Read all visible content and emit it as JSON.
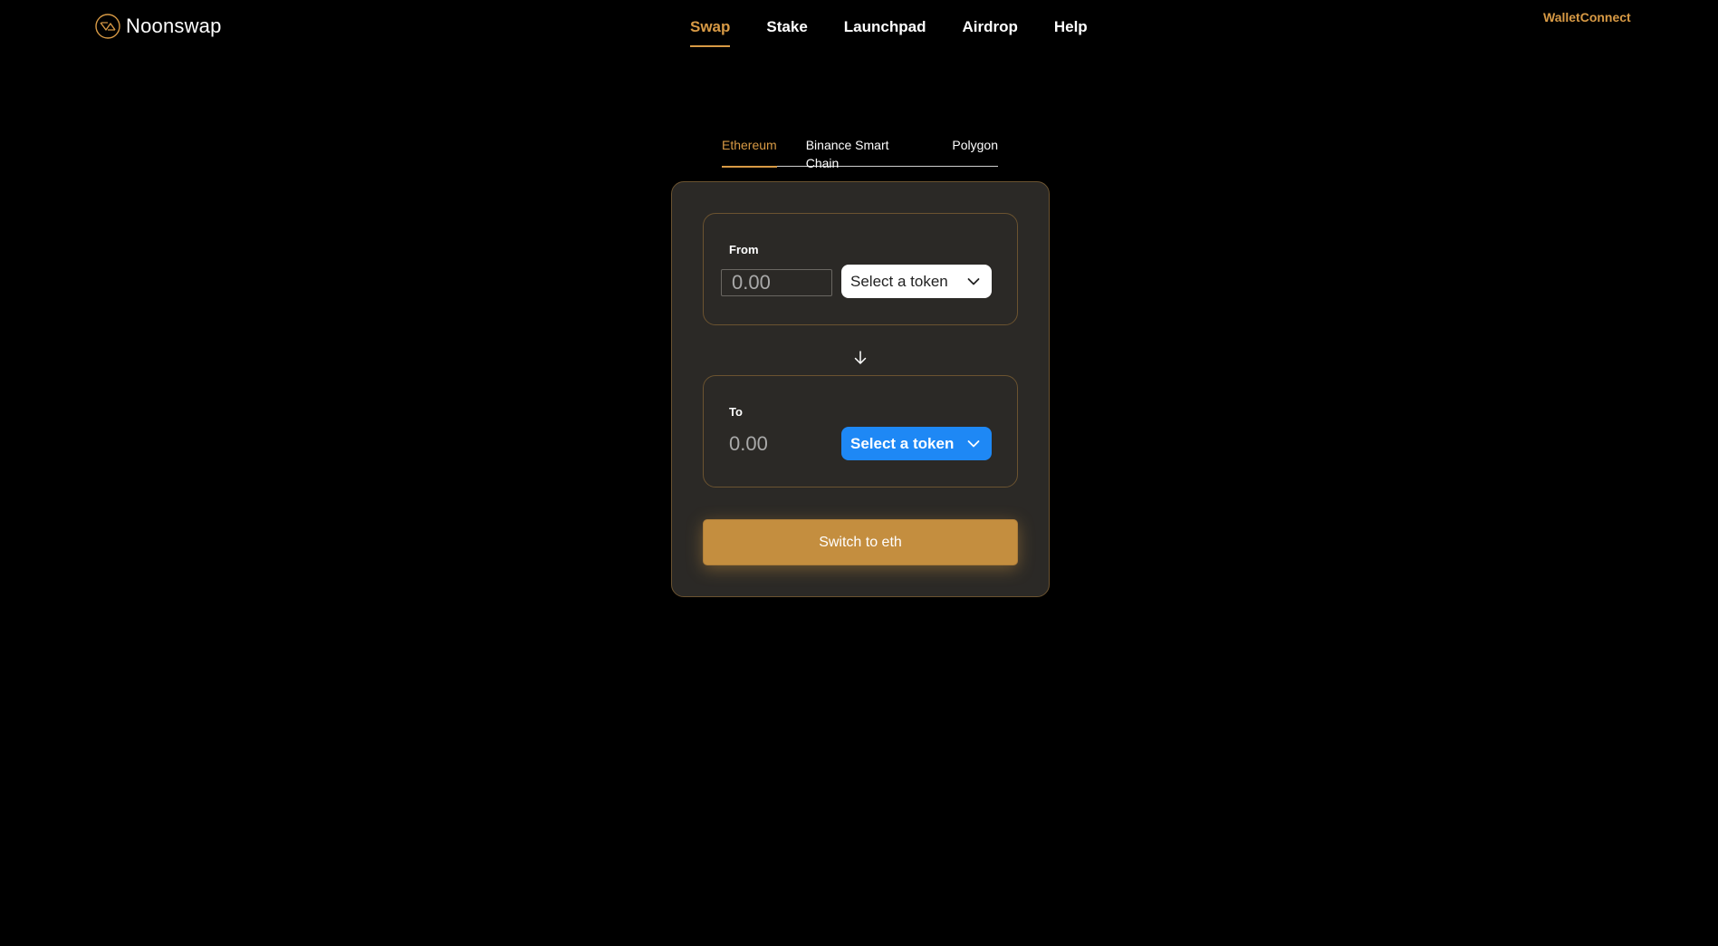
{
  "brand": {
    "name": "Noonswap",
    "logo_icon": "noonswap-logo-icon"
  },
  "nav": {
    "items": [
      {
        "label": "Swap",
        "active": true
      },
      {
        "label": "Stake",
        "active": false
      },
      {
        "label": "Launchpad",
        "active": false
      },
      {
        "label": "Airdrop",
        "active": false
      },
      {
        "label": "Help",
        "active": false
      }
    ]
  },
  "wallet": {
    "label": "WalletConnect"
  },
  "chains": {
    "tabs": [
      {
        "label": "Ethereum",
        "active": true
      },
      {
        "label": "Binance Smart Chain",
        "active": false
      },
      {
        "label": "Polygon",
        "active": false
      }
    ]
  },
  "swap": {
    "from": {
      "label": "From",
      "amount_placeholder": "0.00",
      "token_label": "Select a token"
    },
    "to": {
      "label": "To",
      "amount": "0.00",
      "token_label": "Select a token"
    },
    "direction_icon": "arrow-down-icon",
    "action_label": "Switch to eth"
  },
  "colors": {
    "background": "#000000",
    "accent": "#d89a45",
    "card": "#2b2926",
    "card_border": "#6b5330",
    "token_blue": "#1e88f5",
    "action_button": "#c48e3f"
  }
}
